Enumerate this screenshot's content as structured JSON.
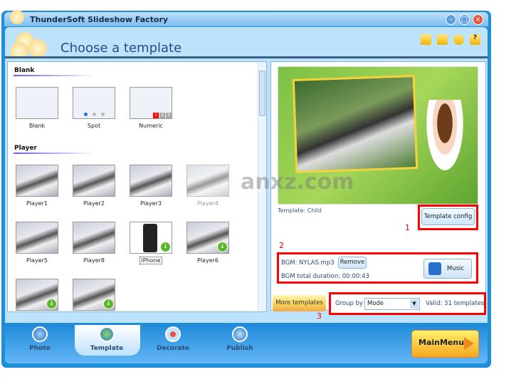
{
  "window": {
    "title": "ThunderSoft Slideshow Factory",
    "controls": [
      "minimize",
      "restore",
      "close"
    ]
  },
  "header": {
    "title": "Choose a template",
    "tool_icons": [
      "folder-icon",
      "save-icon",
      "bulb-icon",
      "help-icon"
    ],
    "help_glyph": "?"
  },
  "templates": {
    "sections": [
      {
        "title": "Blank",
        "items": [
          {
            "label": "Blank"
          },
          {
            "label": "Spot"
          },
          {
            "label": "Numeric",
            "digits": [
              "1",
              "2",
              "3"
            ]
          }
        ]
      },
      {
        "title": "Player",
        "items": [
          {
            "label": "Player1"
          },
          {
            "label": "Player2"
          },
          {
            "label": "Player3"
          },
          {
            "label": "Player4"
          },
          {
            "label": "Player5"
          },
          {
            "label": "Player8"
          },
          {
            "label": "iPhone",
            "selected": true,
            "download": true
          },
          {
            "label": "Player6",
            "download": true
          },
          {
            "label": "",
            "download": true
          },
          {
            "label": "",
            "download": true
          }
        ]
      }
    ]
  },
  "preview": {
    "template_label": "Template: Child",
    "config_button": "Template config",
    "watermark": "anxz.com"
  },
  "bgm": {
    "file": "BGM: NYLAS.mp3",
    "remove_button": "Remove",
    "duration": "BGM total duration: 00:00:43",
    "music_button": "Music"
  },
  "bottom_controls": {
    "more_templates": "More templates",
    "group_by_label": "Group by",
    "group_by_value": "Mode",
    "valid": "Valid: 31 templates"
  },
  "annotations": [
    "1",
    "2",
    "3"
  ],
  "nav": {
    "tabs": [
      {
        "label": "Photo"
      },
      {
        "label": "Template",
        "active": true
      },
      {
        "label": "Decorate"
      },
      {
        "label": "Publish"
      }
    ],
    "main_menu": "MainMenu"
  },
  "colors": {
    "frame": "#1d8fd8",
    "highlight_box": "#ff0000",
    "title_text": "#1e4f86"
  }
}
